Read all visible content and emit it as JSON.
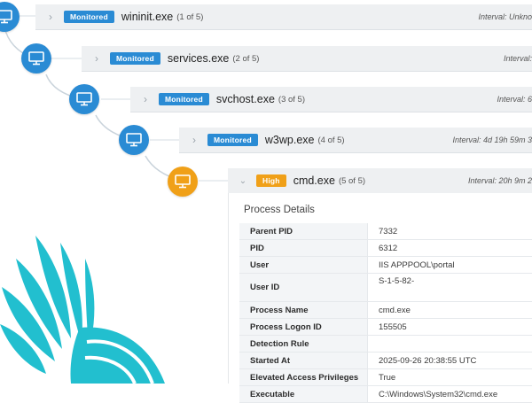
{
  "processes": [
    {
      "name": "wininit.exe",
      "index": "(1 of 5)",
      "badge": "Monitored",
      "interval": "Interval: Unkno",
      "expanded": false
    },
    {
      "name": "services.exe",
      "index": "(2 of 5)",
      "badge": "Monitored",
      "interval": "Interval:",
      "expanded": false
    },
    {
      "name": "svchost.exe",
      "index": "(3 of 5)",
      "badge": "Monitored",
      "interval": "Interval: 6",
      "expanded": false
    },
    {
      "name": "w3wp.exe",
      "index": "(4 of 5)",
      "badge": "Monitored",
      "interval": "Interval: 4d 19h 59m 3",
      "expanded": false
    },
    {
      "name": "cmd.exe",
      "index": "(5 of 5)",
      "badge": "High",
      "interval": "Interval: 20h 9m 2",
      "expanded": true
    }
  ],
  "details": {
    "title": "Process Details",
    "rows": [
      {
        "key": "Parent PID",
        "value": "7332"
      },
      {
        "key": "PID",
        "value": "6312"
      },
      {
        "key": "User",
        "value": "IIS APPPOOL\\portal"
      },
      {
        "key": "User ID",
        "value": "S-1-5-82-"
      },
      {
        "key": "Process Name",
        "value": "cmd.exe"
      },
      {
        "key": "Process Logon ID",
        "value": "155505"
      },
      {
        "key": "Detection Rule",
        "value": ""
      },
      {
        "key": "Started At",
        "value": "2025-09-26 20:38:55 UTC"
      },
      {
        "key": "Elevated Access Privileges",
        "value": "True"
      },
      {
        "key": "Executable",
        "value": "C:\\Windows\\System32\\cmd.exe"
      }
    ]
  },
  "colors": {
    "monitored": "#2a8bd4",
    "high": "#f0a018",
    "brand": "#22bfcf"
  },
  "icons": {
    "node": "computer-monitor-icon",
    "collapsed": "chevron-right-icon",
    "expanded": "chevron-down-icon"
  }
}
